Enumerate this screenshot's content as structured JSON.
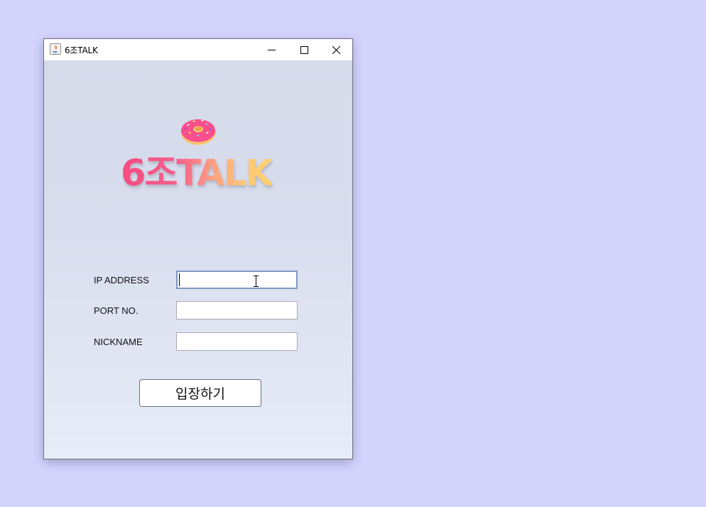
{
  "window": {
    "title": "6조TALK",
    "controls": {
      "minimize": "minimize-icon",
      "maximize": "maximize-icon",
      "close": "close-icon"
    }
  },
  "logo": {
    "text": "6조TALK",
    "icon": "donut-icon",
    "gradient": [
      "#f74b82",
      "#fba383",
      "#fdd170"
    ]
  },
  "form": {
    "ip_label": "IP ADDRESS",
    "ip_value": "",
    "port_label": "PORT NO.",
    "port_value": "",
    "nickname_label": "NICKNAME",
    "nickname_value": "",
    "enter_button": "입장하기"
  },
  "colors": {
    "desktop": "#d4d4fd",
    "focus_border": "#7c9ac4"
  }
}
